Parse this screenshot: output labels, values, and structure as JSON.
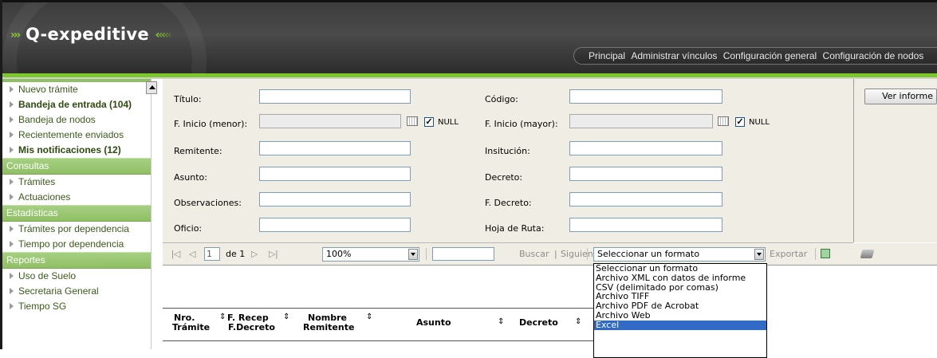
{
  "app": {
    "logo_text": "Q-expeditive",
    "logo_arrows_left": "›››",
    "logo_arrows_right": "‹‹‹‹‹"
  },
  "topnav": {
    "items": [
      "Principal",
      "Administrar vínculos",
      "Configuración general",
      "Configuración de nodos"
    ]
  },
  "sidebar": {
    "items_top": [
      {
        "label": "Nuevo trámite",
        "bold": false
      },
      {
        "label": "Bandeja de entrada (104)",
        "bold": true
      },
      {
        "label": "Bandeja de nodos",
        "bold": false
      },
      {
        "label": "Recientemente enviados",
        "bold": false
      },
      {
        "label": "Mis notificaciones (12)",
        "bold": true
      }
    ],
    "section_consultas": "Consultas",
    "items_consultas": [
      "Trámites",
      "Actuaciones"
    ],
    "section_estadisticas": "Estadísticas",
    "items_estadisticas": [
      "Trámites por dependencia",
      "Tiempo por dependencia"
    ],
    "section_reportes": "Reportes",
    "items_reportes": [
      "Uso de Suelo",
      "Secretaria General",
      "Tiempo SG"
    ]
  },
  "form": {
    "left_labels": [
      "Título:",
      "F. Inicio (menor):",
      "Remitente:",
      "Asunto:",
      "Observaciones:",
      "Oficio:"
    ],
    "right_labels": [
      "Código:",
      "F. Inicio (mayor):",
      "Insitución:",
      "Decreto:",
      "F. Decreto:",
      "Hoja de Ruta:"
    ],
    "null_label": "NULL",
    "null_checked": "✓",
    "ver_informe": "Ver informe"
  },
  "toolbar": {
    "first_icon": "|◁",
    "prev_icon": "◁",
    "next_icon": "▷",
    "last_icon": "▷|",
    "page_value": "1",
    "of_pages": "de 1",
    "zoom": "100%",
    "find_value": "",
    "buscar": "Buscar",
    "pipe": "|",
    "siguiente": "Siguiente",
    "format_selected": "Seleccionar un formato",
    "exportar": "Exportar"
  },
  "export_options": [
    "Seleccionar un formato",
    "Archivo XML con datos de informe",
    "CSV (delimitado por comas)",
    "Archivo TIFF",
    "Archivo PDF de Acrobat",
    "Archivo Web",
    "Excel"
  ],
  "table": {
    "col1_line1": "Nro.",
    "col1_line2": "Trámite",
    "col2_line1": "F. Recep",
    "col2_line2": "F.Decreto",
    "col3_line1": "Nombre",
    "col3_line2": "Remitente",
    "col4": "Asunto",
    "col5": "Decreto",
    "sort_icon": "⇕"
  }
}
